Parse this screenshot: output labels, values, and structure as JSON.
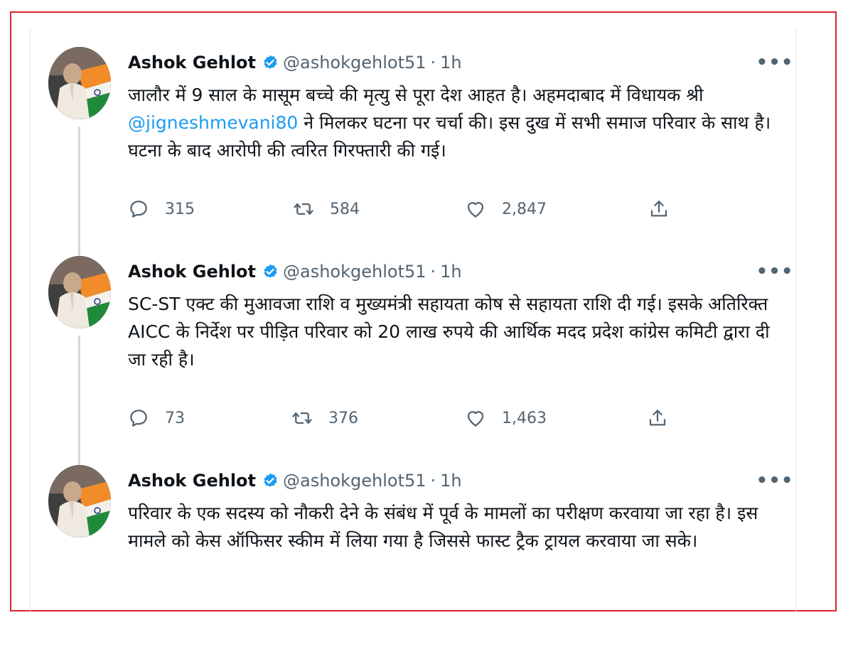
{
  "author": {
    "name": "Ashok Gehlot",
    "handle": "@ashokgehlot51",
    "separator": "·"
  },
  "icons": {
    "more": "more-options-icon",
    "reply": "reply-icon",
    "retweet": "retweet-icon",
    "like": "like-icon",
    "share": "share-icon",
    "verified": "verified-badge-icon"
  },
  "colors": {
    "frame": "#d9232f",
    "verified": "#1d9bf0",
    "mention": "#1d9bf0",
    "muted": "#536471"
  },
  "tweets": [
    {
      "time": "1h",
      "text_before": "जालौर में 9 साल के मासूम बच्चे की मृत्यु से पूरा देश आहत है। अहमदाबाद में विधायक श्री ",
      "mention": "@jigneshmevani80",
      "text_after": " ने मिलकर घटना पर चर्चा की। इस दुख में सभी समाज परिवार के साथ है। घटना के बाद आरोपी की त्वरित गिरफ्तारी की गई।",
      "replies": "315",
      "retweets": "584",
      "likes": "2,847"
    },
    {
      "time": "1h",
      "text": "SC-ST एक्ट की मुआवजा राशि व मुख्यमंत्री सहायता कोष से सहायता राशि दी गई। इसके अतिरिक्त AICC के निर्देश पर पीड़ित परिवार को 20 लाख रुपये की आर्थिक मदद प्रदेश कांग्रेस कमिटी द्वारा दी जा रही है।",
      "replies": "73",
      "retweets": "376",
      "likes": "1,463"
    },
    {
      "time": "1h",
      "text": "परिवार के एक सदस्य को नौकरी देने के संबंध में पूर्व के मामलों का परीक्षण करवाया जा रहा है। इस मामले को केस ऑफिसर स्कीम में लिया गया है जिससे फास्ट ट्रैक ट्रायल करवाया जा सके।"
    }
  ]
}
